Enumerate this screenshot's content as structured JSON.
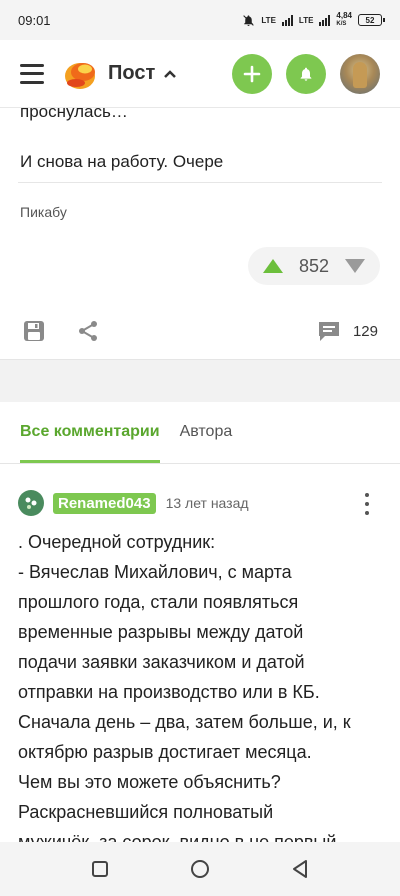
{
  "status": {
    "time": "09:01",
    "net1": "LTE",
    "net2": "LTE",
    "speed_value": "4,84",
    "speed_unit": "K/S",
    "battery": "52"
  },
  "app": {
    "title": "Пост"
  },
  "post": {
    "cut_text": "проснулась…",
    "text": "И снова на работу. Очере",
    "source": "Пикабу",
    "rating": "852",
    "comments_count": "129"
  },
  "comments": {
    "tabs": [
      {
        "label": "Все комментарии"
      },
      {
        "label": "Автора"
      }
    ],
    "first": {
      "author": "Renamed043",
      "time": "13 лет назад",
      "lines": [
        ". Очередной сотрудник:",
        "- Вячеслав Михайлович, с марта",
        "прошлого года, стали появляться",
        "временные разрывы между датой",
        "подачи заявки заказчиком и датой",
        "отправки на производство или в КБ.",
        "Сначала день – два, затем больше, и, к",
        "октябрю разрыв достигает месяца.",
        "Чем вы это можете объяснить?",
        "Раскрасневшийся полноватый",
        "мужичёк, за сорок, видно в не первый"
      ]
    }
  },
  "colors": {
    "accent": "#7ec850",
    "accent_text": "#5aa72e"
  }
}
